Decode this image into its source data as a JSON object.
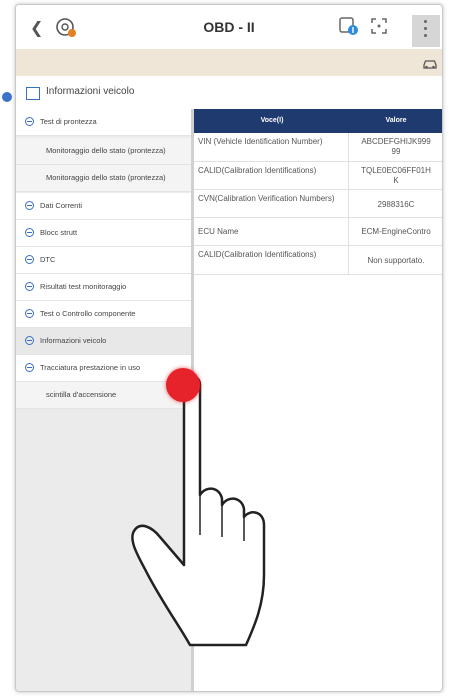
{
  "topbar": {
    "back_icon": "chevron-left-icon",
    "title": "OBD - II"
  },
  "section": {
    "title": "Informazioni veicolo"
  },
  "sidebar": {
    "items": [
      {
        "label": "Test di prontezza",
        "icon": "minus-circle-icon"
      },
      {
        "label": "Monitoraggio dello stato (prontezza)"
      },
      {
        "label": "Monitoraggio dello stato (prontezza)"
      },
      {
        "label": "Dati Correnti",
        "icon": "minus-circle-icon"
      },
      {
        "label": "Blocc strutt",
        "icon": "minus-circle-icon"
      },
      {
        "label": "DTC",
        "icon": "minus-circle-icon"
      },
      {
        "label": "Risultati test monitoraggio",
        "icon": "minus-circle-icon"
      },
      {
        "label": "Test o Controllo componente",
        "icon": "minus-circle-icon"
      },
      {
        "label": "Informazioni veicolo",
        "icon": "minus-circle-icon"
      },
      {
        "label": "Tracciatura prestazione in uso",
        "icon": "minus-circle-icon"
      },
      {
        "label": "scintilla d'accensione"
      }
    ]
  },
  "table": {
    "header": {
      "item": "Voce(I)",
      "value": "Valore"
    },
    "rows": [
      {
        "item": "VIN (Vehicle Identification Number)",
        "value_lines": [
          "ABCDEFGHIJK999",
          "99"
        ]
      },
      {
        "item": "CALID(Calibration Identifications)",
        "value_lines": [
          "TQLE0EC06FF01H",
          "K"
        ]
      },
      {
        "item": "CVN(Calibration Verification Numbers)",
        "value_lines": [
          "2988316C"
        ]
      },
      {
        "item": "ECU Name",
        "value_lines": [
          "ECM-EngineContro"
        ]
      },
      {
        "item": "CALID(Calibration Identifications)",
        "value_lines": [
          "Non supportato."
        ]
      }
    ]
  },
  "colors": {
    "table_header": "#1f3a6e",
    "banner": "#efe6d8",
    "accent": "#3a6fc1",
    "touch_marker": "#e6232a"
  }
}
